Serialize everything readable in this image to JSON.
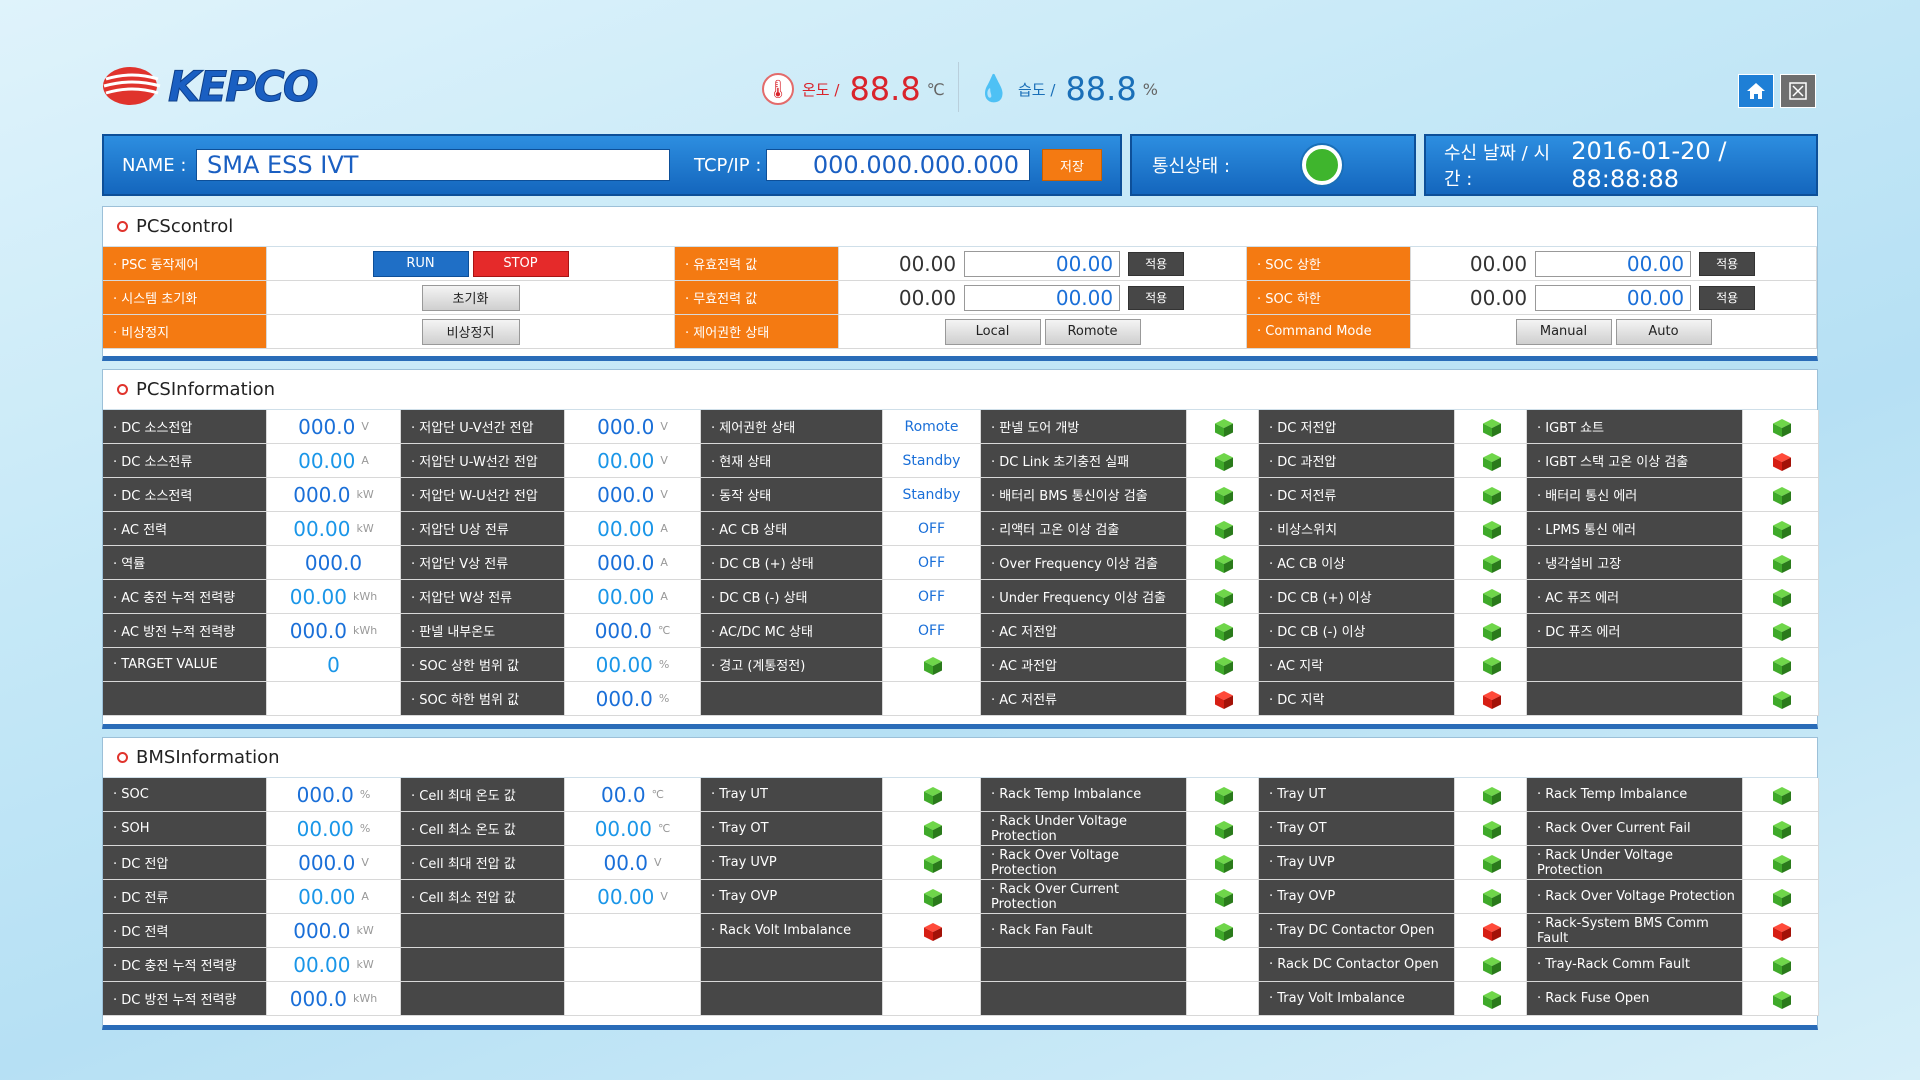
{
  "header": {
    "logo": "KEPCO",
    "temp": {
      "label": "온도 /",
      "value": "88.8",
      "unit": "℃"
    },
    "hum": {
      "label": "습도 /",
      "value": "88.8",
      "unit": "%"
    }
  },
  "topbar": {
    "name_label": "NAME :",
    "name_value": "SMA ESS IVT",
    "tcp_label": "TCP/IP :",
    "tcp_value": "000.000.000.000",
    "save_label": "저장",
    "comm_label": "통신상태 :",
    "date_label": "수신 날짜 / 시간 :",
    "date_value": "2016-01-20 / 88:88:88"
  },
  "pcs_control": {
    "title_bold": "PCS",
    "title_rest": " control",
    "rows": [
      {
        "l1": "· PSC 동작제어",
        "b1": "RUN",
        "b2": "STOP",
        "l2": "· 유효전력 값",
        "v2": "00.00",
        "i2": "00.00",
        "a2": "적용",
        "l3": "· SOC 상한",
        "v3": "00.00",
        "i3": "00.00",
        "a3": "적용"
      },
      {
        "l1": "· 시스템 초기화",
        "b1": "초기화",
        "l2": "· 무효전력 값",
        "v2": "00.00",
        "i2": "00.00",
        "a2": "적용",
        "l3": "· SOC 하한",
        "v3": "00.00",
        "i3": "00.00",
        "a3": "적용"
      },
      {
        "l1": "· 비상정지",
        "b1": "비상정지",
        "l2": "· 제어권한 상태",
        "c1": "Local",
        "c2": "Romote",
        "l3": "· Command Mode",
        "m1": "Manual",
        "m2": "Auto"
      }
    ]
  },
  "pcs_info": {
    "title_bold": "PCS",
    "title_rest": " Information",
    "c1": [
      {
        "label": "· DC 소스전압",
        "value": "000.0",
        "unit": "V"
      },
      {
        "label": "· DC 소스전류",
        "value": "00.00",
        "unit": "A"
      },
      {
        "label": "· DC 소스전력",
        "value": "000.0",
        "unit": "kW"
      },
      {
        "label": "· AC 전력",
        "value": "00.00",
        "unit": "kW"
      },
      {
        "label": "· 역률",
        "value": "000.0",
        "unit": ""
      },
      {
        "label": "· AC 충전 누적 전력량",
        "value": "00.00",
        "unit": "kWh"
      },
      {
        "label": "· AC 방전 누적 전력량",
        "value": "000.0",
        "unit": "kWh"
      },
      {
        "label": "· TARGET VALUE",
        "value": "0",
        "unit": ""
      },
      {
        "label": "",
        "value": "",
        "unit": ""
      }
    ],
    "c2": [
      {
        "label": "· 저압단 U-V선간 전압",
        "value": "000.0",
        "unit": "V"
      },
      {
        "label": "· 저압단 U-W선간 전압",
        "value": "00.00",
        "unit": "V"
      },
      {
        "label": "· 저압단 W-U선간 전압",
        "value": "000.0",
        "unit": "V"
      },
      {
        "label": "· 저압단 U상 전류",
        "value": "00.00",
        "unit": "A"
      },
      {
        "label": "· 저압단 V상 전류",
        "value": "000.0",
        "unit": "A"
      },
      {
        "label": "· 저압단 W상 전류",
        "value": "00.00",
        "unit": "A"
      },
      {
        "label": "· 판넬 내부온도",
        "value": "000.0",
        "unit": "℃"
      },
      {
        "label": "· SOC 상한 범위 값",
        "value": "00.00",
        "unit": "%"
      },
      {
        "label": "· SOC 하한 범위 값",
        "value": "000.0",
        "unit": "%"
      }
    ],
    "c3": [
      {
        "label": "· 제어권한 상태",
        "value": "Romote"
      },
      {
        "label": "· 현재 상태",
        "value": "Standby"
      },
      {
        "label": "· 동작 상태",
        "value": "Standby"
      },
      {
        "label": "· AC CB 상태",
        "value": "OFF"
      },
      {
        "label": "· DC CB (+) 상태",
        "value": "OFF"
      },
      {
        "label": "· DC CB (-) 상태",
        "value": "OFF"
      },
      {
        "label": "· AC/DC MC 상태",
        "value": "OFF"
      },
      {
        "label": "· 경고 (계통정전)",
        "value": "",
        "status": "green"
      },
      {
        "label": "",
        "value": ""
      }
    ],
    "c4": [
      {
        "label": "· 판넬 도어 개방",
        "status": "green"
      },
      {
        "label": "· DC Link 초기충전 실패",
        "status": "green"
      },
      {
        "label": "· 배터리 BMS 통신이상 검출",
        "status": "green"
      },
      {
        "label": "· 리액터 고온 이상 검출",
        "status": "green"
      },
      {
        "label": "· Over Frequency 이상 검출",
        "status": "green"
      },
      {
        "label": "· Under Frequency 이상 검출",
        "status": "green"
      },
      {
        "label": "· AC 저전압",
        "status": "green"
      },
      {
        "label": "· AC 과전압",
        "status": "green"
      },
      {
        "label": "· AC 저전류",
        "status": "red"
      }
    ],
    "c5": [
      {
        "label": "· DC 저전압",
        "status": "green"
      },
      {
        "label": "· DC 과전압",
        "status": "green"
      },
      {
        "label": "· DC 저전류",
        "status": "green"
      },
      {
        "label": "· 비상스위치",
        "status": "green"
      },
      {
        "label": "· AC CB 이상",
        "status": "green"
      },
      {
        "label": "· DC CB (+) 이상",
        "status": "green"
      },
      {
        "label": "· DC CB (-) 이상",
        "status": "green"
      },
      {
        "label": "· AC 지락",
        "status": "green"
      },
      {
        "label": "· DC 지락",
        "status": "red"
      }
    ],
    "c6": [
      {
        "label": "· IGBT 쇼트",
        "status": "green"
      },
      {
        "label": "· IGBT 스택 고온 이상 검출",
        "status": "red"
      },
      {
        "label": "· 배터리 통신 에러",
        "status": "green"
      },
      {
        "label": "· LPMS 통신 에러",
        "status": "green"
      },
      {
        "label": "· 냉각설비 고장",
        "status": "green"
      },
      {
        "label": "· AC 퓨즈 에러",
        "status": "green"
      },
      {
        "label": "· DC 퓨즈 에러",
        "status": "green"
      },
      {
        "label": "",
        "status": "green"
      },
      {
        "label": "",
        "status": "green"
      }
    ]
  },
  "bms_info": {
    "title_bold": "BMS",
    "title_rest": " Information",
    "c1": [
      {
        "label": "· SOC",
        "value": "000.0",
        "unit": "%"
      },
      {
        "label": "· SOH",
        "value": "00.00",
        "unit": "%"
      },
      {
        "label": "· DC 전압",
        "value": "000.0",
        "unit": "V"
      },
      {
        "label": "· DC 전류",
        "value": "00.00",
        "unit": "A"
      },
      {
        "label": "· DC 전력",
        "value": "000.0",
        "unit": "kW"
      },
      {
        "label": "· DC 충전 누적 전력량",
        "value": "00.00",
        "unit": "kW"
      },
      {
        "label": "· DC 방전 누적 전력량",
        "value": "000.0",
        "unit": "kWh"
      }
    ],
    "c2": [
      {
        "label": "· Cell 최대 온도 값",
        "value": "00.0",
        "unit": "℃"
      },
      {
        "label": "· Cell 최소 온도 값",
        "value": "00.00",
        "unit": "℃"
      },
      {
        "label": "· Cell 최대 전압 값",
        "value": "00.0",
        "unit": "V"
      },
      {
        "label": "· Cell 최소 전압 값",
        "value": "00.00",
        "unit": "V"
      },
      {
        "label": "",
        "value": "",
        "unit": ""
      },
      {
        "label": "",
        "value": "",
        "unit": ""
      },
      {
        "label": "",
        "value": "",
        "unit": ""
      }
    ],
    "c3": [
      {
        "label": "· Tray UT",
        "status": "green"
      },
      {
        "label": "· Tray OT",
        "status": "green"
      },
      {
        "label": "· Tray UVP",
        "status": "green"
      },
      {
        "label": "· Tray OVP",
        "status": "green"
      },
      {
        "label": "· Rack Volt Imbalance",
        "status": "red"
      },
      {
        "label": "",
        "status": ""
      },
      {
        "label": "",
        "status": ""
      }
    ],
    "c4": [
      {
        "label": "· Rack Temp Imbalance",
        "status": "green"
      },
      {
        "label": "· Rack Under Voltage Protection",
        "status": "green"
      },
      {
        "label": "· Rack Over Voltage Protection",
        "status": "green"
      },
      {
        "label": "· Rack Over Current Protection",
        "status": "green"
      },
      {
        "label": "· Rack Fan Fault",
        "status": "green"
      },
      {
        "label": "",
        "status": ""
      },
      {
        "label": "",
        "status": ""
      }
    ],
    "c5": [
      {
        "label": "· Tray UT",
        "status": "green"
      },
      {
        "label": "· Tray OT",
        "status": "green"
      },
      {
        "label": "· Tray UVP",
        "status": "green"
      },
      {
        "label": "· Tray OVP",
        "status": "green"
      },
      {
        "label": "· Tray DC Contactor Open",
        "status": "red"
      },
      {
        "label": "· Rack DC Contactor Open",
        "status": "green"
      },
      {
        "label": "· Tray Volt Imbalance",
        "status": "green"
      }
    ],
    "c6": [
      {
        "label": "· Rack Temp Imbalance",
        "status": "green"
      },
      {
        "label": "· Rack Over Current Fail",
        "status": "green"
      },
      {
        "label": "· Rack Under Voltage Protection",
        "status": "green"
      },
      {
        "label": "· Rack Over Voltage Protection",
        "status": "green"
      },
      {
        "label": "· Rack-System BMS Comm Fault",
        "status": "red"
      },
      {
        "label": "· Tray-Rack Comm Fault",
        "status": "green"
      },
      {
        "label": "· Rack Fuse Open",
        "status": "green"
      }
    ]
  },
  "colors": {
    "accent": "#1466bd",
    "orange": "#f47a12",
    "status_ok": "#3fb52d",
    "status_fault": "#e0332c"
  }
}
